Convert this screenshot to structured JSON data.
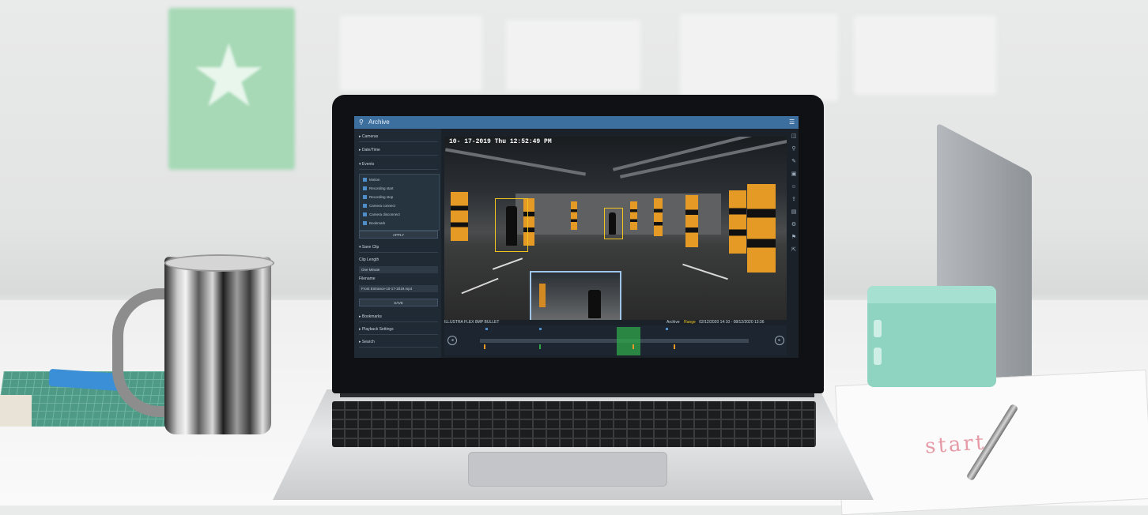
{
  "app": {
    "title": "Archive",
    "menu_icon": "hamburger-icon",
    "search_icon": "search-icon"
  },
  "sidebar": {
    "sections": [
      {
        "label": "Cameras"
      },
      {
        "label": "Date/Time"
      },
      {
        "label": "Events"
      }
    ],
    "events": [
      {
        "label": "Motion",
        "checked": true
      },
      {
        "label": "Recording start",
        "checked": true
      },
      {
        "label": "Recording stop",
        "checked": true
      },
      {
        "label": "Camera connect",
        "checked": true
      },
      {
        "label": "Camera disconnect",
        "checked": true
      },
      {
        "label": "Bookmark",
        "checked": true
      }
    ],
    "apply_label": "APPLY",
    "save_clip": {
      "section_label": "Save Clip",
      "clip_length_label": "Clip Length",
      "clip_length_value": "One Minute",
      "filename_label": "Filename",
      "filename_value": "Front Entrance-10-17-2019.mp4",
      "save_label": "SAVE"
    },
    "lower_sections": [
      {
        "label": "Bookmarks"
      },
      {
        "label": "Playback Settings"
      },
      {
        "label": "Search"
      }
    ]
  },
  "video": {
    "timestamp": "10- 17-2019  Thu  12:52:49  PM",
    "camera_name": "ILLUSTRA FLEX 8MP BULLET",
    "mode_label": "Archive",
    "range_label": "Range",
    "range_value": "02/12/2020 14:10 - 08/12/2020 13:36"
  },
  "right_toolbar": {
    "icons": [
      "camera-icon",
      "search-icon",
      "pen-icon",
      "image-icon",
      "user-icon",
      "export-icon",
      "lock-icon",
      "settings-icon",
      "flag-icon",
      "share-icon"
    ]
  },
  "colors": {
    "titlebar": "#3d6f9e",
    "panel": "#1f2a34",
    "bbox": "#f2c41e",
    "timeline_selection": "#2fa84a",
    "pillar": "#e59a25",
    "speaker": "#8fd3c1",
    "star_card": "#a7d9b6"
  },
  "scene": {
    "paper_sketch_text": "start"
  }
}
